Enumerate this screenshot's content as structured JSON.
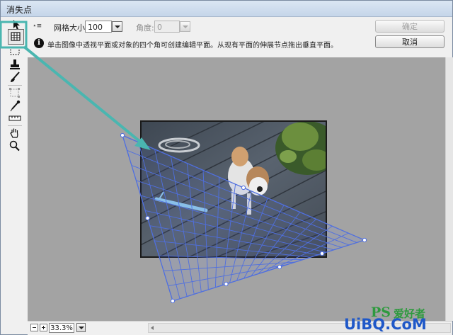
{
  "window": {
    "title": "消失点"
  },
  "options": {
    "grid_size_label": "网格大小:",
    "grid_size_value": "100",
    "angle_label": "角度:",
    "angle_value": "0",
    "info_text": "单击图像中透视平面或对象的四个角可创建编辑平面。从现有平面的伸展节点拖出垂直平面。"
  },
  "buttons": {
    "ok": "确定",
    "cancel": "取消"
  },
  "status": {
    "zoom": "33.3%"
  },
  "watermark": {
    "brand_ps": "PS",
    "brand_cn": "爱好者",
    "site": "UiBQ.CoM"
  },
  "colors": {
    "highlight": "#4ab6b0",
    "grid": "#4f6fe0",
    "canvas": "#a3a3a3",
    "wm_green": "#2e9a3e",
    "wm_blue": "#1f58c8"
  },
  "icons": [
    "edit-plane-tool-icon",
    "create-plane-tool-icon",
    "marquee-tool-icon",
    "stamp-tool-icon",
    "brush-tool-icon",
    "transform-tool-icon",
    "eyedropper-tool-icon",
    "measure-tool-icon",
    "hand-tool-icon",
    "zoom-tool-icon",
    "info-icon"
  ]
}
